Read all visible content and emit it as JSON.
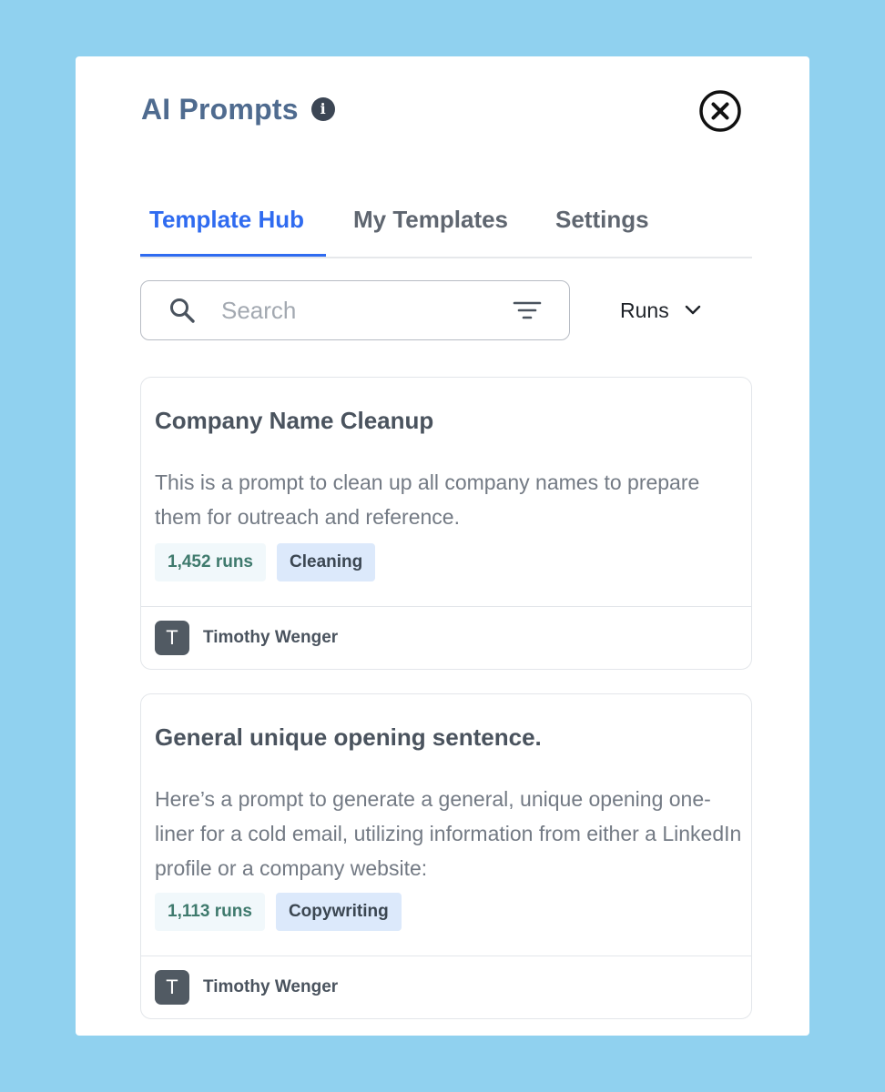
{
  "header": {
    "title": "AI Prompts",
    "info_glyph": "i",
    "info_icon": "info-icon",
    "close_icon": "close-circle-icon"
  },
  "tabs": [
    {
      "label": "Template Hub",
      "active": true
    },
    {
      "label": "My Templates",
      "active": false
    },
    {
      "label": "Settings",
      "active": false
    }
  ],
  "search": {
    "placeholder": "Search",
    "icon": "search-icon",
    "filter_icon": "filter-icon"
  },
  "sort": {
    "selected": "Runs",
    "icon": "chevron-down-icon"
  },
  "templates": [
    {
      "title": "Company Name Cleanup",
      "description": "This is a prompt to clean up all company names to prepare them for outreach and reference.",
      "runs": "1,452 runs",
      "tag": "Cleaning",
      "author_initial": "T",
      "author": "Timothy Wenger"
    },
    {
      "title": "General unique opening sentence.",
      "description": "Here’s a prompt to generate a general, unique opening one-liner for a cold email, utilizing information from either a LinkedIn profile or a company website:",
      "runs": "1,113 runs",
      "tag": "Copywriting",
      "author_initial": "T",
      "author": "Timothy Wenger"
    }
  ],
  "colors": {
    "background": "#90d1ef",
    "accent": "#2f6bf0",
    "title": "#4f6b8f",
    "tag_bg": "#dce9fb",
    "runs_text": "#3f7a6d"
  }
}
